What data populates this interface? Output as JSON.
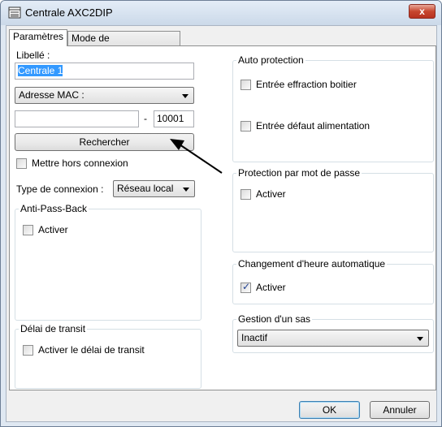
{
  "window": {
    "title": "Centrale AXC2DIP",
    "close_glyph": "x"
  },
  "tabs": [
    {
      "label": "Paramètres",
      "active": true
    },
    {
      "label": "Mode de fonctionnement",
      "active": false
    }
  ],
  "left": {
    "libelle_label": "Libellé :",
    "libelle_value": "Centrale 1",
    "address_combo": "Adresse MAC :",
    "address_value": "",
    "port_separator": "-",
    "port_value": "10001",
    "search_button": "Rechercher",
    "offline_checkbox": {
      "label": "Mettre hors connexion",
      "checked": false
    },
    "connection_label": "Type de connexion :",
    "connection_value": "Réseau local",
    "anti_pass_back": {
      "title": "Anti-Pass-Back",
      "checkbox_label": "Activer",
      "checked": false
    },
    "transit": {
      "title": "Délai de transit",
      "checkbox_label": "Activer le délai de transit",
      "checked": false
    }
  },
  "right": {
    "auto_protection": {
      "title": "Auto protection",
      "items": [
        {
          "label": "Entrée effraction boitier",
          "checked": false
        },
        {
          "label": "Entrée défaut alimentation",
          "checked": false
        }
      ]
    },
    "password": {
      "title": "Protection par mot de passe",
      "checkbox_label": "Activer",
      "checked": false
    },
    "dst": {
      "title": "Changement d'heure automatique",
      "checkbox_label": "Activer",
      "checked": true
    },
    "airlock": {
      "title": "Gestion d'un sas",
      "value": "Inactif"
    }
  },
  "footer": {
    "ok": "OK",
    "cancel": "Annuler"
  },
  "colors": {
    "accent": "#3399ff",
    "close": "#c7462e",
    "arrow": "#000000"
  }
}
